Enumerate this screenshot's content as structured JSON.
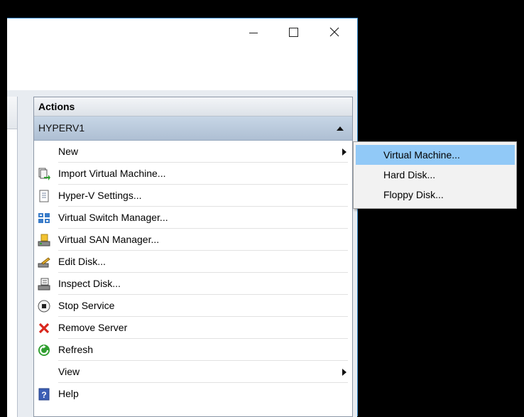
{
  "window_controls": {
    "minimize": "—",
    "maximize": "☐",
    "close": "✕"
  },
  "actions_pane": {
    "title": "Actions",
    "group": "HYPERV1",
    "items": [
      {
        "label": "New",
        "icon": "none",
        "submenu": true
      },
      {
        "label": "Import Virtual Machine...",
        "icon": "import-vm-icon"
      },
      {
        "label": "Hyper-V Settings...",
        "icon": "settings-icon"
      },
      {
        "label": "Virtual Switch Manager...",
        "icon": "switch-manager-icon"
      },
      {
        "label": "Virtual SAN Manager...",
        "icon": "san-manager-icon"
      },
      {
        "label": "Edit Disk...",
        "icon": "edit-disk-icon"
      },
      {
        "label": "Inspect Disk...",
        "icon": "inspect-disk-icon"
      },
      {
        "label": "Stop Service",
        "icon": "stop-icon"
      },
      {
        "label": "Remove Server",
        "icon": "remove-x-icon"
      },
      {
        "label": "Refresh",
        "icon": "refresh-icon"
      },
      {
        "label": "View",
        "icon": "none",
        "submenu": true
      },
      {
        "label": "Help",
        "icon": "help-icon"
      }
    ]
  },
  "new_submenu": {
    "items": [
      {
        "label": "Virtual Machine...",
        "highlighted": true
      },
      {
        "label": "Hard Disk..."
      },
      {
        "label": "Floppy Disk..."
      }
    ]
  },
  "colors": {
    "highlight": "#91c9f7",
    "group_header": "#b9c9dc",
    "remove_red": "#d9261c",
    "refresh_green": "#2f9e2f",
    "help_blue": "#3c5fb5"
  }
}
